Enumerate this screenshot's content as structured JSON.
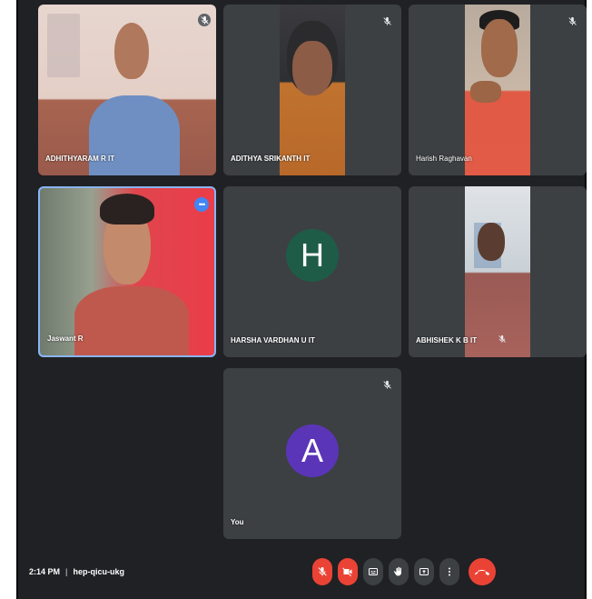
{
  "participants": [
    {
      "name": "ADHITHYARAM R IT"
    },
    {
      "name": "ADITHYA SRIKANTH IT"
    },
    {
      "name": "Harish Raghavan"
    },
    {
      "name": "Jaswant R"
    },
    {
      "name": "HARSHA VARDHAN U IT",
      "initial": "H"
    },
    {
      "name": "ABHISHEK K B IT"
    },
    {
      "name": "You",
      "initial": "A"
    }
  ],
  "meeting": {
    "time": "2:14 PM",
    "separator": "|",
    "code": "hep-qicu-ukg"
  },
  "icons": {
    "mute": "mic-off-icon",
    "camera_off": "camera-off-icon",
    "captions": "captions-icon",
    "raise_hand": "raise-hand-icon",
    "present": "present-icon",
    "more": "more-options-icon",
    "hangup": "hangup-icon"
  },
  "colors": {
    "background": "#202124",
    "tile": "#3c4043",
    "red": "#ea4335",
    "avatar_h": "#1e5c47",
    "avatar_a": "#5b35b7",
    "active_border": "#8ab4f8"
  }
}
